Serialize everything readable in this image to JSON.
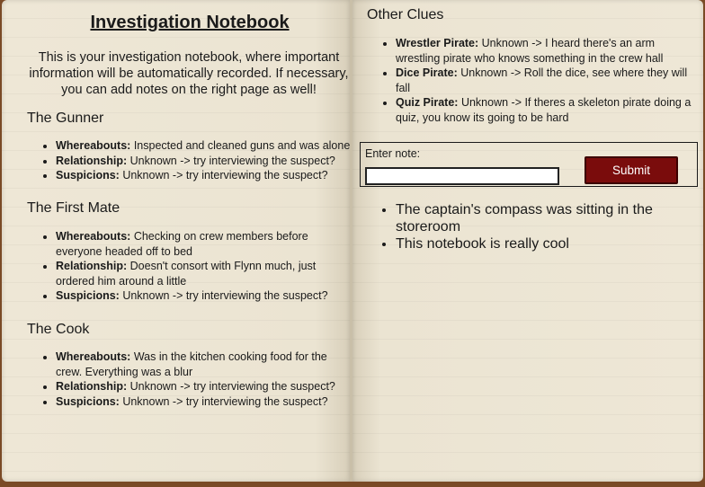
{
  "notebook": {
    "title": "Investigation Notebook",
    "intro": "This is your investigation notebook, where important information will be automatically recorded. If necessary, you can add notes on the right page as well!"
  },
  "suspects": [
    {
      "name": "The Gunner",
      "whereabouts_label": "Whereabouts:",
      "whereabouts": " Inspected and cleaned guns and was alone",
      "relationship_label": "Relationship:",
      "relationship": " Unknown -> try interviewing the suspect?",
      "suspicions_label": "Suspicions:",
      "suspicions": " Unknown -> try interviewing the suspect?"
    },
    {
      "name": "The First Mate",
      "whereabouts_label": "Whereabouts:",
      "whereabouts": " Checking on crew members before everyone headed off to bed",
      "relationship_label": "Relationship:",
      "relationship": " Doesn't consort with Flynn much, just ordered him around a little",
      "suspicions_label": "Suspicions:",
      "suspicions": " Unknown -> try interviewing the suspect?"
    },
    {
      "name": "The Cook",
      "whereabouts_label": "Whereabouts:",
      "whereabouts": " Was in the kitchen cooking food for the crew. Everything was a blur",
      "relationship_label": "Relationship:",
      "relationship": " Unknown -> try interviewing the suspect?",
      "suspicions_label": "Suspicions:",
      "suspicions": " Unknown -> try interviewing the suspect?"
    }
  ],
  "other_clues": {
    "heading": "Other Clues",
    "items": [
      {
        "label": "Wrestler Pirate:",
        "text": " Unknown -> I heard there's an arm wrestling pirate who knows something in the crew hall"
      },
      {
        "label": "Dice Pirate:",
        "text": " Unknown -> Roll the dice, see where they will fall"
      },
      {
        "label": "Quiz Pirate:",
        "text": " Unknown -> If theres a skeleton pirate doing a quiz, you know its going to be hard"
      }
    ]
  },
  "note_form": {
    "label": "Enter note:",
    "value": "",
    "submit_label": "Submit"
  },
  "notes": [
    "The captain's compass was sitting in the storeroom",
    "This notebook is really cool"
  ],
  "colors": {
    "page": "#eee7d6",
    "cover": "#7a4a26",
    "submit": "#7a0c0c"
  }
}
